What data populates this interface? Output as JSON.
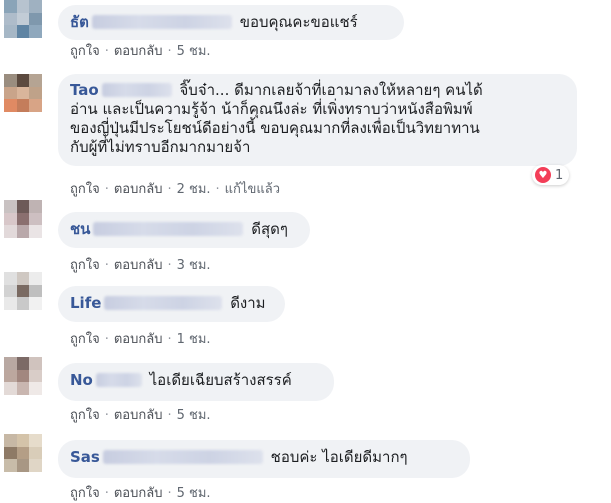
{
  "labels": {
    "like": "ถูกใจ",
    "reply": "ตอบกลับ",
    "dot": "·"
  },
  "comments": [
    {
      "name": "ธัต",
      "text": "ขอบคุณคะขอแชร์",
      "time": "5 ชม.",
      "avatar": [
        "#8aa4b8",
        "#b7c3cf",
        "#9fb1c1",
        "#aebcca",
        "#c2ccd6",
        "#7f98ad",
        "#a6b7c6",
        "#5f84a3",
        "#8fa8bd"
      ]
    },
    {
      "name": "Tao",
      "text_lines": [
        "จิ๊บจ๋า... ดีมากเลยจ้าที่เอามาลงให้หลายๆ คนได้",
        "อ่าน และเป็นความรู้จ้า น้าก็คุณนึงล่ะ ที่เพิ่งทราบว่าหนังสือพิมพ์",
        "ของญี่ปุ่นมีประโยชน์ดีอย่างนี้ ขอบคุณมากที่ลงเพื่อเป็นวิทยาทาน",
        "กับผู้ที่ไม่ทราบอีกมากมายจ้า"
      ],
      "time": "2 ชม.",
      "edited": "แก้ไขแล้ว",
      "reaction_count": "1",
      "avatar": [
        "#9a8d7f",
        "#5c4a3f",
        "#b5a493",
        "#c9a48a",
        "#d9b59b",
        "#bfa289",
        "#e08a63",
        "#c47d5b",
        "#d8a486"
      ]
    },
    {
      "name": "ชน",
      "text": "ดีสุดๆ",
      "time": "3 ชม.",
      "avatar": [
        "#c9c2c2",
        "#6d5a58",
        "#bfb3b3",
        "#d8c7c9",
        "#8a6f6f",
        "#cdbfc1",
        "#e2d9da",
        "#b9a8aa",
        "#eae4e5"
      ]
    },
    {
      "name": "Life",
      "text": "ดีงาม",
      "time": "1 ชม.",
      "avatar": [
        "#e0e0e0",
        "#cfc8c2",
        "#ececec",
        "#d2d2d2",
        "#7a6a62",
        "#bfbfbf",
        "#e9e9e9",
        "#c9c9c9",
        "#f1f1f1"
      ]
    },
    {
      "name": "No",
      "text": "ไอเดียเฉียบสร้างสรรค์",
      "time": "5 ชม.",
      "avatar": [
        "#b8a8a2",
        "#7c6a66",
        "#d0c3be",
        "#bca79e",
        "#a2877f",
        "#d9cdc8",
        "#e3dad7",
        "#c9b6b0",
        "#efe9e7"
      ]
    },
    {
      "name": "Sas",
      "text": "ชอบค่ะ ไอเดียดีมากๆ",
      "time": "5 ชม.",
      "avatar": [
        "#c7b8a5",
        "#d4c3a9",
        "#e6dccb",
        "#8e7a66",
        "#b49e86",
        "#d9cdb9",
        "#c8bca9",
        "#a89784",
        "#e0d6c6"
      ]
    }
  ]
}
